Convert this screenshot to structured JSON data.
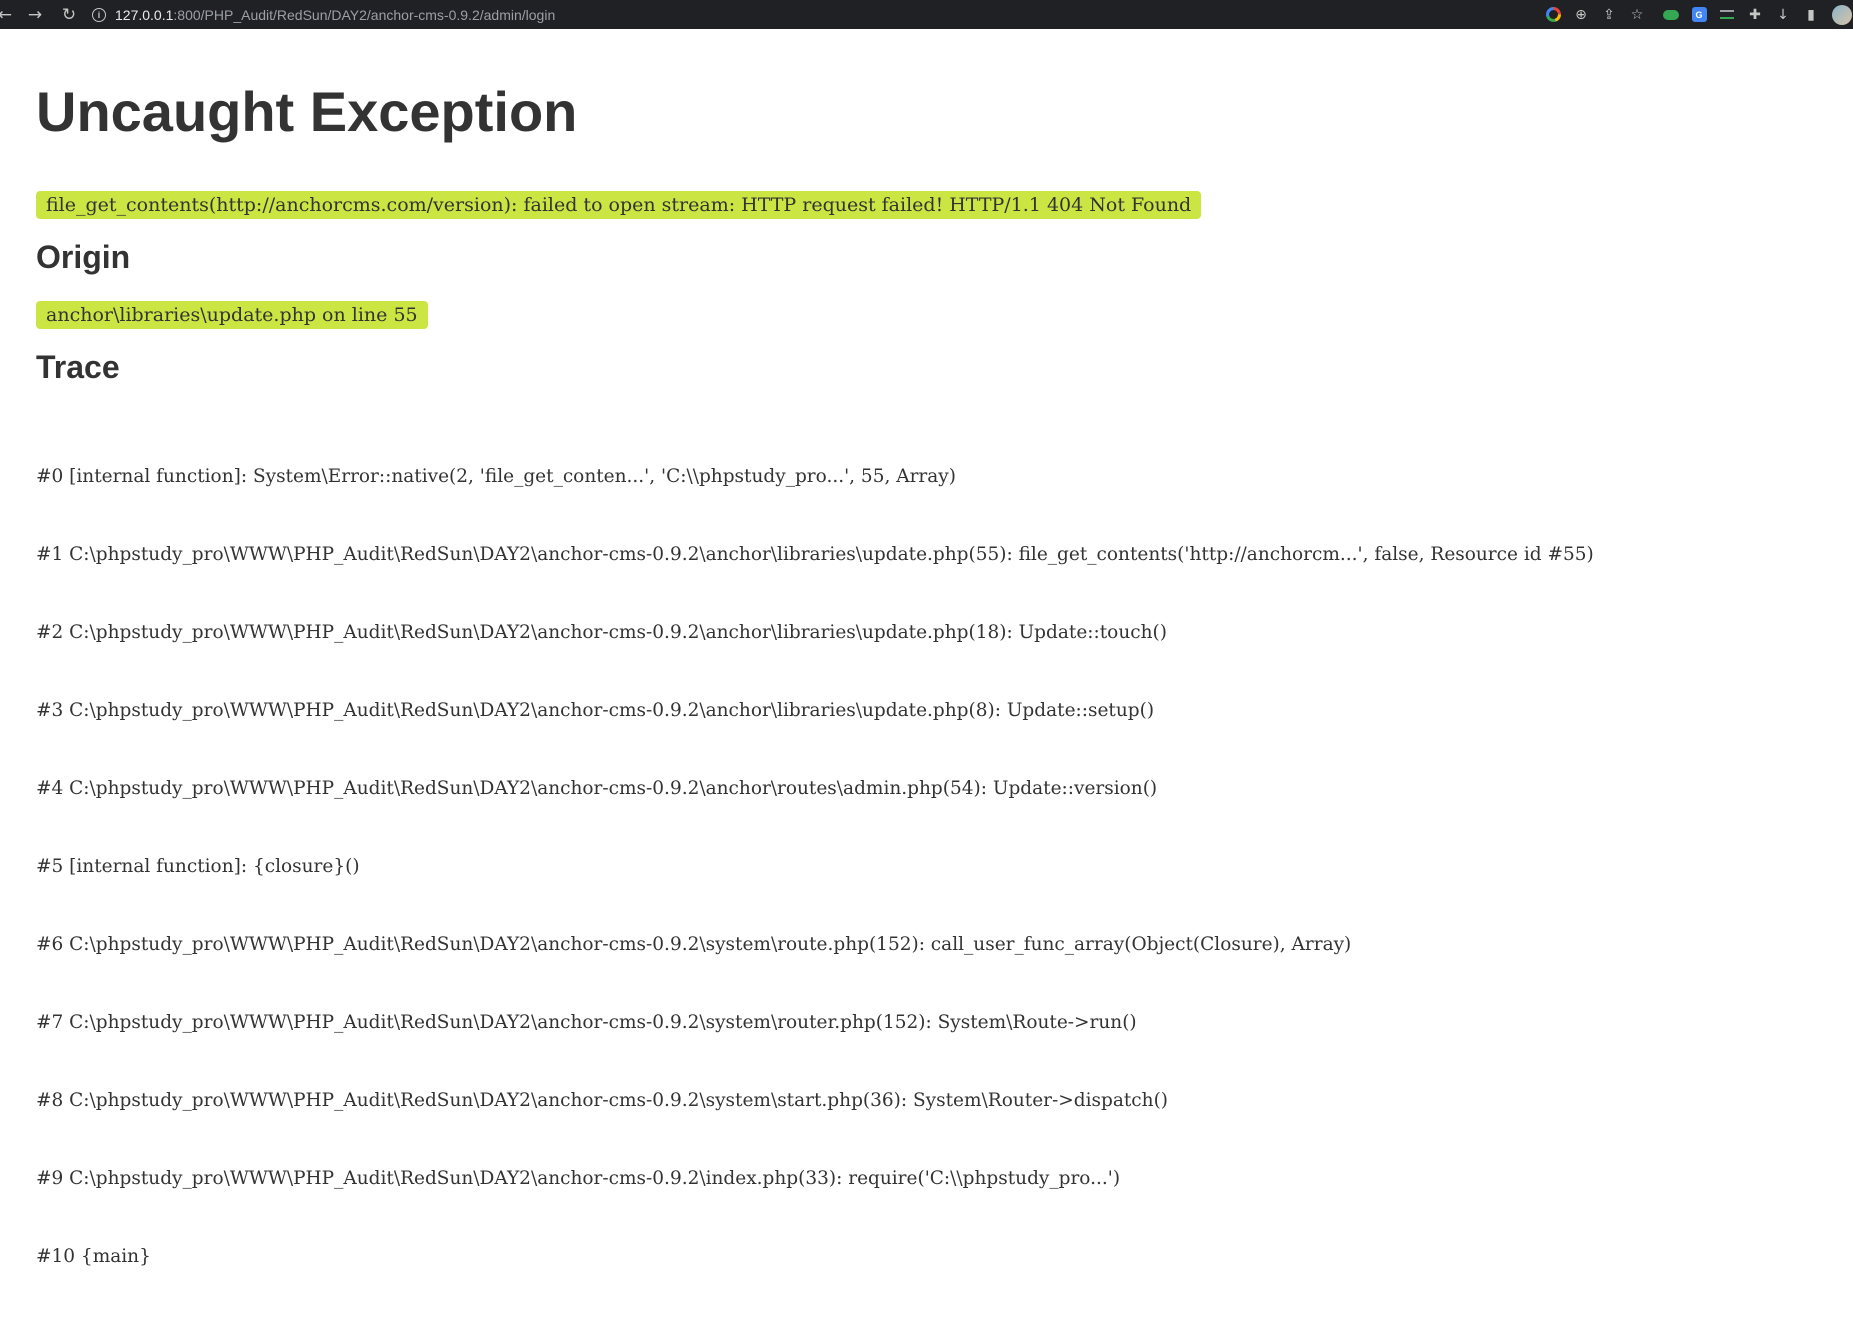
{
  "browser": {
    "url_host": "127.0.0.1",
    "url_path": ":800/PHP_Audit/RedSun/DAY2/anchor-cms-0.9.2/admin/login",
    "toolbar_icons": [
      "google-lens-icon",
      "zoom-icon",
      "share-icon",
      "bookmark-star-icon",
      "extension-toggle-icon",
      "translate-icon",
      "extension-list-icon",
      "puzzle-icon",
      "download-icon",
      "sidebar-icon",
      "profile-avatar"
    ]
  },
  "page": {
    "title": "Uncaught Exception",
    "message": "file_get_contents(http://anchorcms.com/version): failed to open stream: HTTP request failed! HTTP/1.1 404 Not Found",
    "origin_heading": "Origin",
    "origin": "anchor\\libraries\\update.php on line 55",
    "trace_heading": "Trace",
    "trace": [
      "#0 [internal function]: System\\Error::native(2, 'file_get_conten...', 'C:\\\\phpstudy_pro...', 55, Array)",
      "#1 C:\\phpstudy_pro\\WWW\\PHP_Audit\\RedSun\\DAY2\\anchor-cms-0.9.2\\anchor\\libraries\\update.php(55): file_get_contents('http://anchorcm...', false, Resource id #55)",
      "#2 C:\\phpstudy_pro\\WWW\\PHP_Audit\\RedSun\\DAY2\\anchor-cms-0.9.2\\anchor\\libraries\\update.php(18): Update::touch()",
      "#3 C:\\phpstudy_pro\\WWW\\PHP_Audit\\RedSun\\DAY2\\anchor-cms-0.9.2\\anchor\\libraries\\update.php(8): Update::setup()",
      "#4 C:\\phpstudy_pro\\WWW\\PHP_Audit\\RedSun\\DAY2\\anchor-cms-0.9.2\\anchor\\routes\\admin.php(54): Update::version()",
      "#5 [internal function]: {closure}()",
      "#6 C:\\phpstudy_pro\\WWW\\PHP_Audit\\RedSun\\DAY2\\anchor-cms-0.9.2\\system\\route.php(152): call_user_func_array(Object(Closure), Array)",
      "#7 C:\\phpstudy_pro\\WWW\\PHP_Audit\\RedSun\\DAY2\\anchor-cms-0.9.2\\system\\router.php(152): System\\Route->run()",
      "#8 C:\\phpstudy_pro\\WWW\\PHP_Audit\\RedSun\\DAY2\\anchor-cms-0.9.2\\system\\start.php(36): System\\Router->dispatch()",
      "#9 C:\\phpstudy_pro\\WWW\\PHP_Audit\\RedSun\\DAY2\\anchor-cms-0.9.2\\index.php(33): require('C:\\\\phpstudy_pro...')",
      "#10 {main}"
    ]
  },
  "colors": {
    "highlight": "#cbe643",
    "text": "#333333",
    "chrome_bg": "#202124"
  }
}
